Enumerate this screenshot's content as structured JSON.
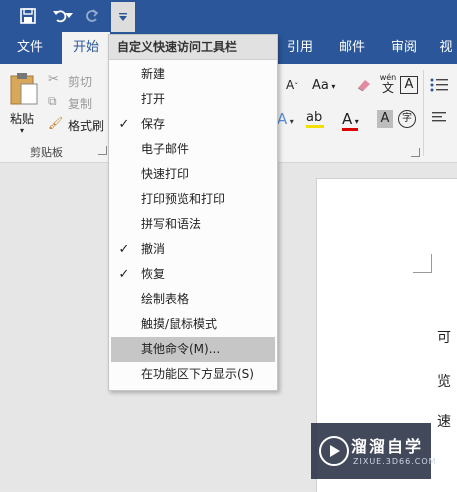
{
  "qat": {
    "save_icon": "save-icon",
    "undo_icon": "undo-icon",
    "redo_icon": "redo-icon",
    "customize_icon": "customize-qat-icon"
  },
  "tabs": [
    {
      "label": "文件"
    },
    {
      "label": "开始"
    },
    {
      "label": "引用"
    },
    {
      "label": "邮件"
    },
    {
      "label": "审阅"
    },
    {
      "label": "视"
    }
  ],
  "ribbon": {
    "paste_label": "粘贴",
    "cut_label": "剪切",
    "copy_label": "复制",
    "format_painter_label": "格式刷",
    "clipboard_group": "剪贴板",
    "font_glyph_aa": "Aa",
    "font_glyph_wen": "wén",
    "font_glyph_wen_char": "文",
    "font_glyph_a": "A",
    "char_enclose": "字"
  },
  "menu": {
    "title": "自定义快速访问工具栏",
    "items": [
      {
        "label": "新建",
        "checked": false
      },
      {
        "label": "打开",
        "checked": false
      },
      {
        "label": "保存",
        "checked": true
      },
      {
        "label": "电子邮件",
        "checked": false
      },
      {
        "label": "快速打印",
        "checked": false
      },
      {
        "label": "打印预览和打印",
        "checked": false
      },
      {
        "label": "拼写和语法",
        "checked": false
      },
      {
        "label": "撤消",
        "checked": true
      },
      {
        "label": "恢复",
        "checked": true
      },
      {
        "label": "绘制表格",
        "checked": false
      },
      {
        "label": "触摸/鼠标模式",
        "checked": false
      },
      {
        "label": "其他命令(M)...",
        "checked": false,
        "highlighted": true
      },
      {
        "label": "在功能区下方显示(S)",
        "checked": false
      }
    ],
    "check_glyph": "✓"
  },
  "document": {
    "line1": "可",
    "line2": "览",
    "line3": "速"
  },
  "watermark": {
    "brand": "溜溜自学",
    "url": "ZIXUE.3D66.COM"
  }
}
